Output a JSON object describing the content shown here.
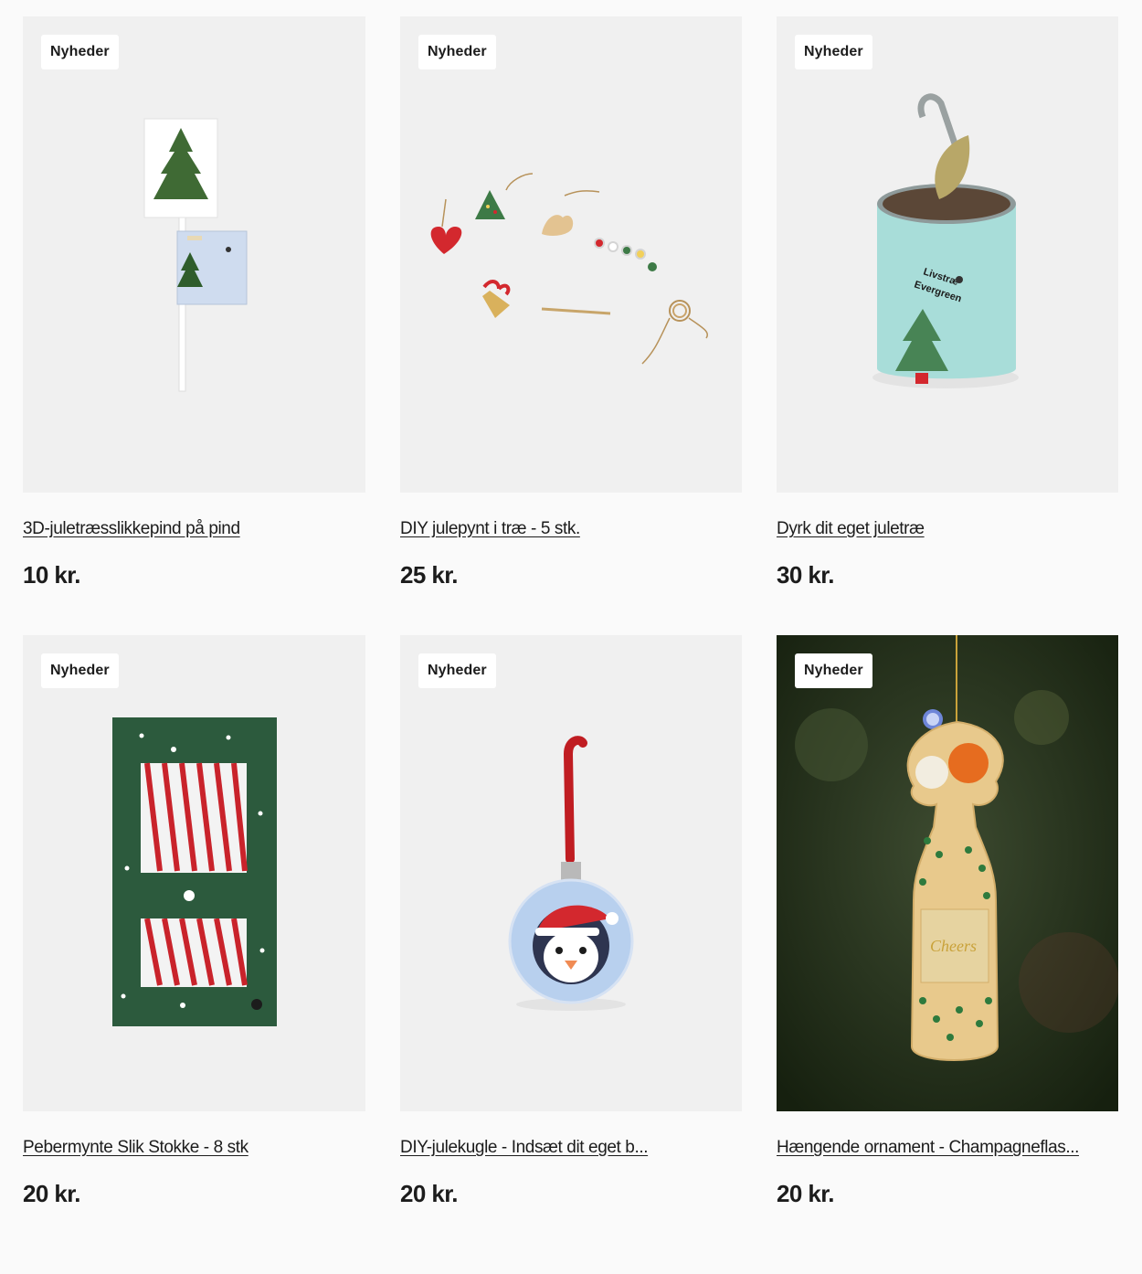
{
  "products": [
    {
      "badge": "Nyheder",
      "image": "3d-christmas-tree-lollipop-icon",
      "title": "3D-juletræsslikkepind på pind",
      "price": "10 kr."
    },
    {
      "badge": "Nyheder",
      "image": "diy-wooden-ornaments-icon",
      "title": "DIY julepynt i træ - 5 stk.",
      "price": "25 kr."
    },
    {
      "badge": "Nyheder",
      "image": "grow-your-own-tree-can-icon",
      "title": "Dyrk dit eget juletræ",
      "price": "30 kr."
    },
    {
      "badge": "Nyheder",
      "image": "peppermint-candy-canes-box-icon",
      "title": "Pebermynte Slik Stokke - 8 stk",
      "price": "20 kr."
    },
    {
      "badge": "Nyheder",
      "image": "penguin-bauble-icon",
      "title": "DIY-julekugle - Indsæt dit eget b...",
      "price": "20 kr."
    },
    {
      "badge": "Nyheder",
      "image": "champagne-bottle-ornament-icon",
      "title": "Hængende ornament - Champagneflas...",
      "price": "20 kr."
    }
  ],
  "can_label": {
    "line1": "Livstræ",
    "line2": "Evergreen"
  },
  "bottle_label": "Cheers",
  "colors": {
    "card_bg": "#f0f0f0",
    "badge_bg": "#ffffff",
    "text": "#1c1c1c",
    "page_bg": "#fafafa"
  }
}
